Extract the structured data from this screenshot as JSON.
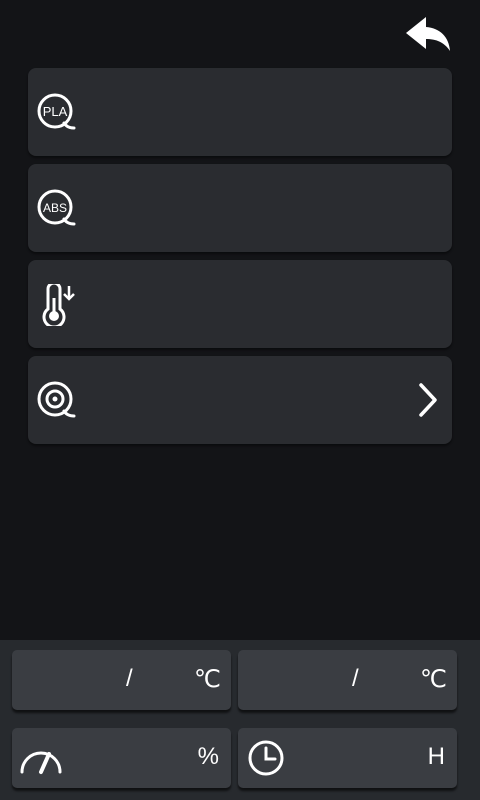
{
  "header": {
    "back_icon": "back-arrow-icon"
  },
  "menu": {
    "items": [
      {
        "icon": "pla-filament-icon",
        "icon_text": "PLA",
        "label": ""
      },
      {
        "icon": "abs-filament-icon",
        "icon_text": "ABS",
        "label": ""
      },
      {
        "icon": "cooldown-thermometer-icon",
        "label": ""
      },
      {
        "icon": "filament-spool-icon",
        "label": "",
        "chevron": "chevron-right-icon"
      }
    ]
  },
  "status": {
    "nozzle": {
      "current": "",
      "separator": "/",
      "target": "",
      "unit": "℃"
    },
    "bed": {
      "current": "",
      "separator": "/",
      "target": "",
      "unit": "℃"
    },
    "speed": {
      "icon": "speed-gauge-icon",
      "value": "",
      "unit": "%"
    },
    "time": {
      "icon": "clock-icon",
      "value": "",
      "unit": "H"
    }
  },
  "colors": {
    "background": "#131417",
    "card": "#2a2c30",
    "panel": "#272a2e",
    "tile": "#3a3d42"
  }
}
